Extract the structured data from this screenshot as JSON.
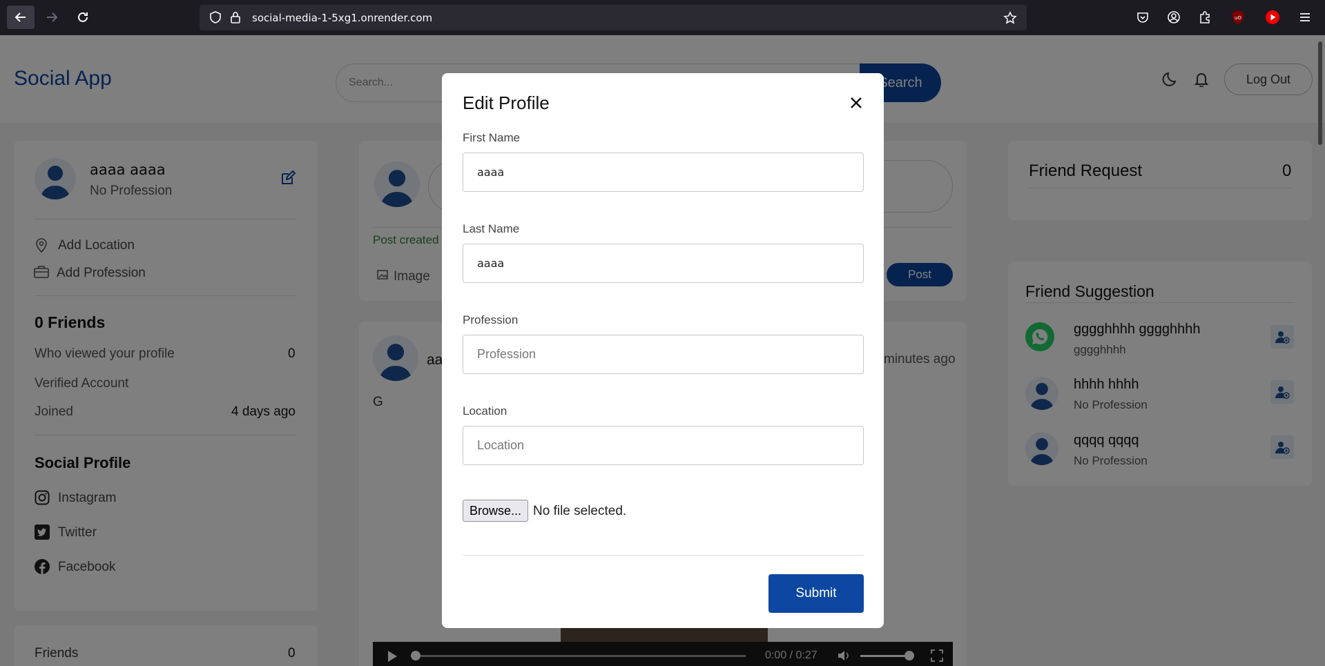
{
  "browser": {
    "url": "social-media-1-5xg1.onrender.com"
  },
  "header": {
    "brand": "Social App",
    "search_placeholder": "Search...",
    "search_button": "Search",
    "logout": "Log Out"
  },
  "profile_card": {
    "name": "aaaa aaaa",
    "profession": "No Profession",
    "add_location": "Add Location",
    "add_profession": "Add Profession",
    "friends_heading": "0 Friends",
    "who_viewed_label": "Who viewed your profile",
    "who_viewed_value": "0",
    "verified": "Verified Account",
    "joined_label": "Joined",
    "joined_value": "4 days ago",
    "social_heading": "Social Profile",
    "instagram": "Instagram",
    "twitter": "Twitter",
    "facebook": "Facebook"
  },
  "friends_card": {
    "label": "Friends",
    "value": "0"
  },
  "composer": {
    "status": "Post created",
    "image": "Image",
    "post_button": "Post"
  },
  "feed_post": {
    "author_partial": "aa",
    "time": "minutes ago",
    "text": "G",
    "video_time": "0:00 / 0:27"
  },
  "friend_request": {
    "title": "Friend Request",
    "count": "0"
  },
  "friend_suggestion": {
    "title": "Friend Suggestion",
    "items": [
      {
        "name": "gggghhhh gggghhhh",
        "sub": "gggghhhh"
      },
      {
        "name": "hhhh hhhh",
        "sub": "No Profession"
      },
      {
        "name": "qqqq qqqq",
        "sub": "No Profession"
      }
    ]
  },
  "modal": {
    "title": "Edit Profile",
    "first_name_label": "First Name",
    "first_name_value": "aaaa",
    "last_name_label": "Last Name",
    "last_name_value": "aaaa",
    "profession_label": "Profession",
    "profession_placeholder": "Profession",
    "location_label": "Location",
    "location_placeholder": "Location",
    "browse_label": "Browse...",
    "file_status": "No file selected.",
    "submit": "Submit"
  },
  "colors": {
    "brand": "#0d47a1",
    "accent_green": "#2e7d32"
  }
}
